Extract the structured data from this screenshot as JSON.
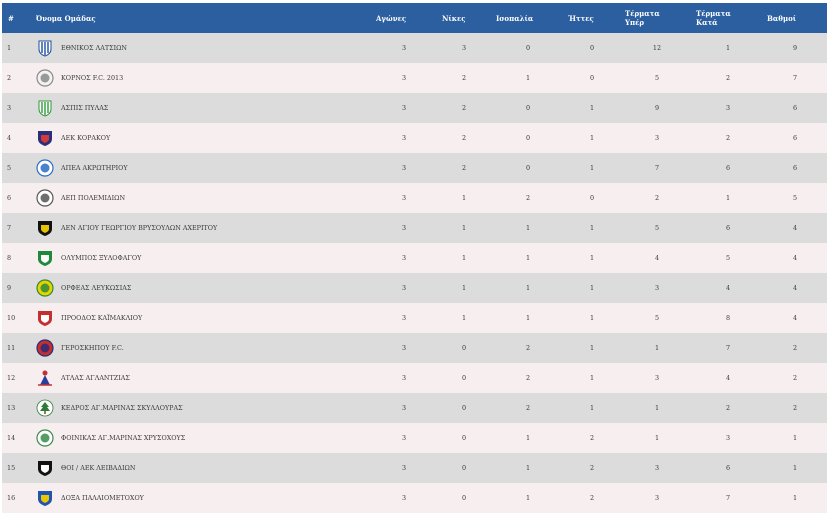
{
  "header": {
    "pos": "#",
    "team": "Όνομα Ομάδας",
    "played": "Αγώνες",
    "wins": "Νίκες",
    "draws": "Ισοπαλία",
    "losses": "Ήττες",
    "goals_for_1": "Τέρματα",
    "goals_for_2": "Υπέρ",
    "goals_against_1": "Τέρματα",
    "goals_against_2": "Κατά",
    "points": "Βαθμοί"
  },
  "rows": [
    {
      "pos": "1",
      "team": "ΕΘΝΙΚΟΣ ΛΑΤΣΙΩΝ",
      "p": "3",
      "w": "3",
      "d": "0",
      "l": "0",
      "gf": "12",
      "ga": "1",
      "pts": "9",
      "crest": "stripes-crest-icon",
      "c1": "#1f4fa0",
      "c2": "#ffffff"
    },
    {
      "pos": "2",
      "team": "ΚΟΡΝΟΣ F.C. 2013",
      "p": "3",
      "w": "2",
      "d": "1",
      "l": "0",
      "gf": "5",
      "ga": "2",
      "pts": "7",
      "crest": "round-crest-icon",
      "c1": "#8a8a8a",
      "c2": "#f2f2f2"
    },
    {
      "pos": "3",
      "team": "ΑΣΠΙΣ ΠΥΛΑΣ",
      "p": "3",
      "w": "2",
      "d": "0",
      "l": "1",
      "gf": "9",
      "ga": "3",
      "pts": "6",
      "crest": "stripes-crest-icon",
      "c1": "#2e9a3a",
      "c2": "#ffffff"
    },
    {
      "pos": "4",
      "team": "ΑΕΚ ΚΟΡΑΚΟΥ",
      "p": "3",
      "w": "2",
      "d": "0",
      "l": "1",
      "gf": "3",
      "ga": "2",
      "pts": "6",
      "crest": "shield-crest-icon",
      "c1": "#2a2f7a",
      "c2": "#d23a3a"
    },
    {
      "pos": "5",
      "team": "ΑΠΕΑ ΑΚΡΩΤΗΡΙΟΥ",
      "p": "3",
      "w": "2",
      "d": "0",
      "l": "1",
      "gf": "7",
      "ga": "6",
      "pts": "6",
      "crest": "round-crest-icon",
      "c1": "#2b6cc4",
      "c2": "#ffffff"
    },
    {
      "pos": "6",
      "team": "ΑΕΠ ΠΟΛΕΜΙΔΙΩΝ",
      "p": "3",
      "w": "1",
      "d": "2",
      "l": "0",
      "gf": "2",
      "ga": "1",
      "pts": "5",
      "crest": "round-crest-icon",
      "c1": "#555555",
      "c2": "#ffffff"
    },
    {
      "pos": "7",
      "team": "ΑΕΝ ΑΓΙΟΥ ΓΕΩΡΓΙΟΥ ΒΡΥΣΟΥΛΩΝ ΑΧΕΡΙΤΟΥ",
      "p": "3",
      "w": "1",
      "d": "1",
      "l": "1",
      "gf": "5",
      "ga": "6",
      "pts": "4",
      "crest": "shield-crest-icon",
      "c1": "#111111",
      "c2": "#e6c200"
    },
    {
      "pos": "8",
      "team": "ΟΛΥΜΠΟΣ ΞΥΛΟΦΑΓΟΥ",
      "p": "3",
      "w": "1",
      "d": "1",
      "l": "1",
      "gf": "4",
      "ga": "5",
      "pts": "4",
      "crest": "shield-crest-icon",
      "c1": "#1e8a3a",
      "c2": "#ffffff"
    },
    {
      "pos": "9",
      "team": "ΟΡΦΕΑΣ ΛΕΥΚΩΣΙΑΣ",
      "p": "3",
      "w": "1",
      "d": "1",
      "l": "1",
      "gf": "3",
      "ga": "4",
      "pts": "4",
      "crest": "round-crest-icon",
      "c1": "#2e8b3a",
      "c2": "#e8d200"
    },
    {
      "pos": "10",
      "team": "ΠΡΟΟΔΟΣ ΚΑΪΜΑΚΛΙΟΥ",
      "p": "3",
      "w": "1",
      "d": "1",
      "l": "1",
      "gf": "5",
      "ga": "8",
      "pts": "4",
      "crest": "shield-crest-icon",
      "c1": "#c43030",
      "c2": "#ffffff"
    },
    {
      "pos": "11",
      "team": "ΓΕΡΟΣΚΗΠΟΥ F.C.",
      "p": "3",
      "w": "0",
      "d": "2",
      "l": "1",
      "gf": "1",
      "ga": "7",
      "pts": "2",
      "crest": "round-crest-icon",
      "c1": "#2a2a7a",
      "c2": "#c43030"
    },
    {
      "pos": "12",
      "team": "ΑΤΛΑΣ ΑΓΛΑΝΤΖΙΑΣ",
      "p": "3",
      "w": "0",
      "d": "2",
      "l": "1",
      "gf": "3",
      "ga": "4",
      "pts": "2",
      "crest": "figure-crest-icon",
      "c1": "#2a3f9a",
      "c2": "#c43030"
    },
    {
      "pos": "13",
      "team": "ΚΕΔΡΟΣ ΑΓ.ΜΑΡΙΝΑΣ ΣΚΥΛΛΟΥΡΑΣ",
      "p": "3",
      "w": "0",
      "d": "2",
      "l": "1",
      "gf": "1",
      "ga": "2",
      "pts": "2",
      "crest": "tree-crest-icon",
      "c1": "#2e7a3a",
      "c2": "#ffffff"
    },
    {
      "pos": "14",
      "team": "ΦΟΙΝΙΚΑΣ ΑΓ.ΜΑΡΙΝΑΣ ΧΡΥΣΟΧΟΥΣ",
      "p": "3",
      "w": "0",
      "d": "1",
      "l": "2",
      "gf": "1",
      "ga": "3",
      "pts": "1",
      "crest": "round-crest-icon",
      "c1": "#3a8a4a",
      "c2": "#ffffff"
    },
    {
      "pos": "15",
      "team": "ΘΟΙ / ΑΕΚ ΛΕΙΒΑΔΙΩΝ",
      "p": "3",
      "w": "0",
      "d": "1",
      "l": "2",
      "gf": "3",
      "ga": "6",
      "pts": "1",
      "crest": "shield-crest-icon",
      "c1": "#111111",
      "c2": "#ffffff"
    },
    {
      "pos": "16",
      "team": "ΔΟΞΑ ΠΑΛΑΙΟΜΕΤΟΧΟΥ",
      "p": "3",
      "w": "0",
      "d": "1",
      "l": "2",
      "gf": "3",
      "ga": "7",
      "pts": "1",
      "crest": "shield-crest-icon",
      "c1": "#1f55b0",
      "c2": "#e8c800"
    }
  ]
}
